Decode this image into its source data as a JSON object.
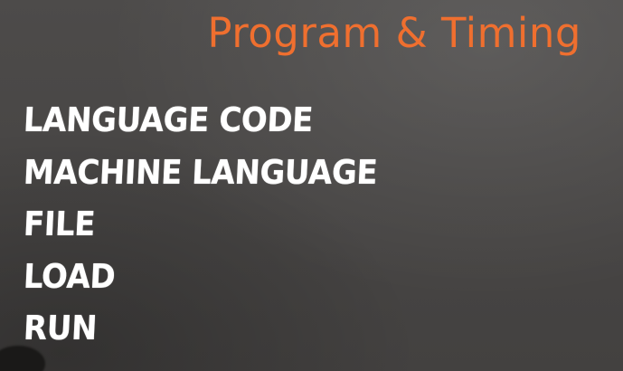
{
  "slide": {
    "title": "Program & Timing",
    "items": [
      "LANGUAGE CODE",
      "MACHINE LANGUAGE",
      "FILE",
      "LOAD",
      "RUN"
    ]
  },
  "colors": {
    "background": "#4a4847",
    "title": "#ef6f2f",
    "items": "#ffffff"
  }
}
